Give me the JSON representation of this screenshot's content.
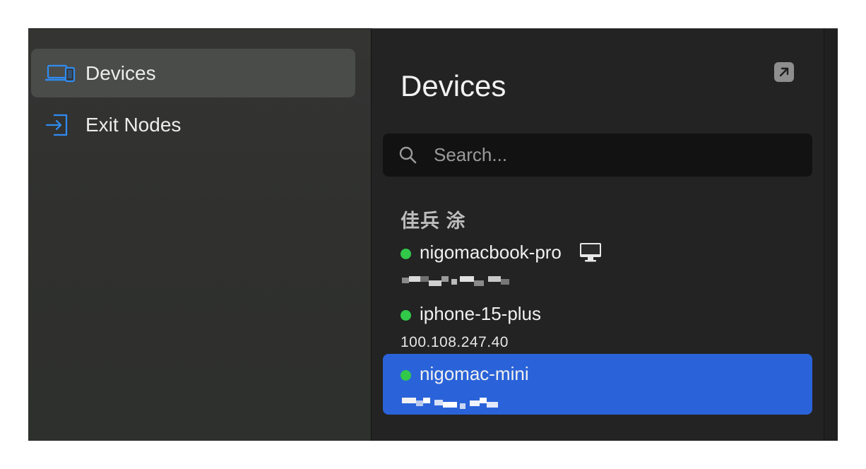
{
  "sidebar": {
    "items": [
      {
        "label": "Devices",
        "icon": "devices-icon",
        "selected": true
      },
      {
        "label": "Exit Nodes",
        "icon": "exit-node-icon",
        "selected": false
      }
    ]
  },
  "main": {
    "title": "Devices",
    "expand_icon": "arrow-up-right-icon",
    "search": {
      "placeholder": "Search..."
    },
    "owner": "佳兵 涂",
    "devices": [
      {
        "name": "nigomacbook-pro",
        "status": "online",
        "ip": "",
        "ip_redacted": true,
        "icon": "monitor-icon",
        "selected": false
      },
      {
        "name": "iphone-15-plus",
        "status": "online",
        "ip": "100.108.247.40",
        "ip_redacted": false,
        "selected": false
      },
      {
        "name": "nigomac-mini",
        "status": "online",
        "ip": "",
        "ip_redacted": true,
        "selected": true
      }
    ]
  },
  "colors": {
    "accent": "#2a63d9",
    "online": "#32c84a",
    "icon_blue": "#2f8cf3"
  }
}
